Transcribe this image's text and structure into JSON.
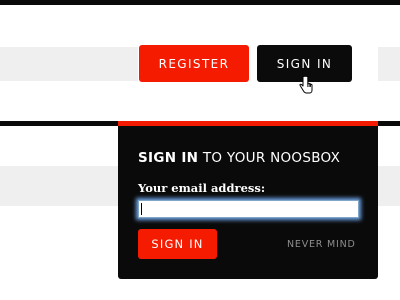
{
  "header": {
    "register_label": "REGISTER",
    "signin_label": "SIGN IN"
  },
  "signin_panel": {
    "title_bold": "SIGN IN",
    "title_rest": " TO YOUR NOOSBOX",
    "email_label": "Your email address:",
    "email_value": "",
    "submit_label": "SIGN IN",
    "cancel_label": "NEVER MIND"
  },
  "colors": {
    "accent": "#f51b00",
    "dark": "#0a0a0a",
    "stripe": "#efefef",
    "focus_glow": "#6fa5e8",
    "muted_text": "#8e8e8e"
  },
  "icons": {
    "cursor": "hand-pointer-icon"
  }
}
